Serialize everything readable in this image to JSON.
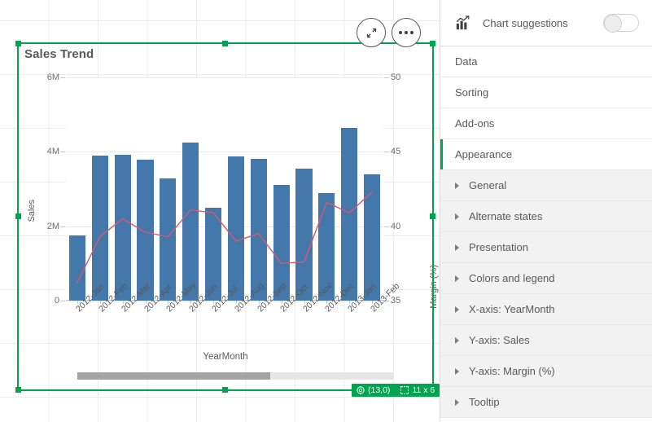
{
  "chart": {
    "title": "Sales Trend",
    "x_axis_title": "YearMonth",
    "y_left_title": "Sales",
    "y_right_title": "Margin (%)"
  },
  "toolbar": {
    "fullscreen_icon": "expand-icon",
    "more_icon": "ellipsis-icon"
  },
  "status_badge": {
    "position_icon": "target-icon",
    "position": "(13,0)",
    "size_icon": "resize-icon",
    "size": "11 x 6"
  },
  "panel": {
    "header": {
      "icon": "chart-suggestions-icon",
      "label": "Chart suggestions",
      "toggle_on": false
    },
    "sections": [
      {
        "label": "Data",
        "expandable": false,
        "active": false
      },
      {
        "label": "Sorting",
        "expandable": false,
        "active": false
      },
      {
        "label": "Add-ons",
        "expandable": false,
        "active": false
      },
      {
        "label": "Appearance",
        "expandable": false,
        "active": true
      }
    ],
    "subsections": [
      {
        "label": "General"
      },
      {
        "label": "Alternate states"
      },
      {
        "label": "Presentation"
      },
      {
        "label": "Colors and legend"
      },
      {
        "label": "X-axis: YearMonth"
      },
      {
        "label": "Y-axis: Sales"
      },
      {
        "label": "Y-axis: Margin (%)"
      },
      {
        "label": "Tooltip"
      }
    ]
  },
  "colors": {
    "bar": "#4477aa",
    "line": "#d9596b",
    "accent_green": "#00a44e",
    "grid": "#dedede",
    "text": "#595959"
  },
  "chart_data": {
    "type": "bar",
    "title": "Sales Trend",
    "xlabel": "YearMonth",
    "ylabel": "Sales",
    "y2label": "Margin (%)",
    "ylim": [
      0,
      6000000
    ],
    "y2lim": [
      35,
      50
    ],
    "ytick_labels": [
      "0",
      "2M",
      "4M",
      "6M"
    ],
    "ytick_values": [
      0,
      2000000,
      4000000,
      6000000
    ],
    "y2tick_labels": [
      "35",
      "40",
      "45",
      "50"
    ],
    "y2tick_values": [
      35,
      40,
      45,
      50
    ],
    "grid": true,
    "legend": "none",
    "categories": [
      "2012-Jan",
      "2012-Feb",
      "2012-Mar",
      "2012-Apr",
      "2012-May",
      "2012-Jun",
      "2012-Jul",
      "2012-Aug",
      "2012-Sep",
      "2012-Oct",
      "2012-Nov",
      "2012-Dec",
      "2013-Jan",
      "2013-Feb"
    ],
    "series": [
      {
        "name": "Sales",
        "type": "bar",
        "axis": "left",
        "color": "#4477aa",
        "values": [
          1750000,
          3900000,
          3930000,
          3780000,
          3280000,
          4250000,
          2500000,
          3870000,
          3820000,
          3100000,
          3550000,
          2900000,
          4650000,
          3400000
        ]
      },
      {
        "name": "Margin (%)",
        "type": "line",
        "axis": "right",
        "color": "#d9596b",
        "values": [
          36.2,
          39.3,
          40.5,
          39.6,
          39.3,
          41.1,
          40.9,
          39.0,
          39.5,
          37.5,
          37.6,
          41.6,
          40.9,
          42.3
        ]
      }
    ],
    "scrollbar": {
      "visible": true,
      "thumb_fraction": 0.61,
      "thumb_offset": 0.0
    }
  }
}
